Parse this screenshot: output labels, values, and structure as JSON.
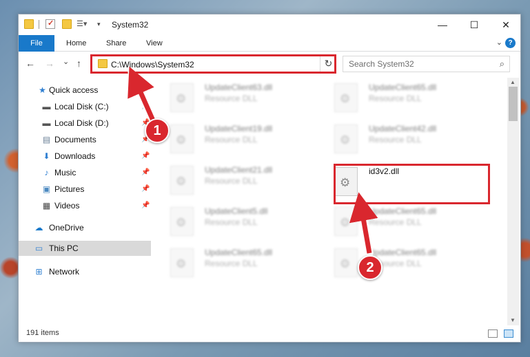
{
  "window": {
    "title": "System32",
    "minimize": "—",
    "maximize": "☐",
    "close": "✕"
  },
  "ribbon": {
    "tabs": [
      "File",
      "Home",
      "Share",
      "View"
    ],
    "help": "?"
  },
  "address": {
    "back": "←",
    "forward": "→",
    "recent": "⌄",
    "up": "↑",
    "path": "C:\\Windows\\System32",
    "search_placeholder": "Search System32"
  },
  "navpane": {
    "items": [
      {
        "label": "Quick access",
        "icon": "star-icon"
      },
      {
        "label": "Local Disk (C:)",
        "icon": "drive-icon",
        "pinned": true
      },
      {
        "label": "Local Disk (D:)",
        "icon": "drive-icon",
        "pinned": true
      },
      {
        "label": "Documents",
        "icon": "documents-icon",
        "pinned": true
      },
      {
        "label": "Downloads",
        "icon": "download-icon",
        "pinned": true
      },
      {
        "label": "Music",
        "icon": "music-icon",
        "pinned": true
      },
      {
        "label": "Pictures",
        "icon": "pictures-icon",
        "pinned": true
      },
      {
        "label": "Videos",
        "icon": "videos-icon",
        "pinned": true
      },
      {
        "label": "OneDrive",
        "icon": "cloud-icon"
      },
      {
        "label": "This PC",
        "icon": "computer-icon",
        "selected": true
      },
      {
        "label": "Network",
        "icon": "network-icon"
      }
    ]
  },
  "files": [
    {
      "name": "UpdateClient63.dll",
      "type": "Resource DLL"
    },
    {
      "name": "UpdateClient65.dll",
      "type": "Resource DLL"
    },
    {
      "name": "UpdateClient19.dll",
      "type": "Resource DLL"
    },
    {
      "name": "UpdateClient42.dll",
      "type": "Resource DLL"
    },
    {
      "name": "UpdateClient21.dll",
      "type": "Resource DLL"
    },
    {
      "name": "id3v2.dll",
      "type": ""
    },
    {
      "name": "UpdateClient5.dll",
      "type": "Resource DLL"
    },
    {
      "name": "UpdateClient65.dll",
      "type": "Resource DLL"
    },
    {
      "name": "UpdateClient65.dll",
      "type": "Resource DLL"
    },
    {
      "name": "UpdateClient65.dll",
      "type": "Resource DLL"
    }
  ],
  "status": {
    "item_count": "191 items"
  },
  "annotations": {
    "step1": "1",
    "step2": "2",
    "color": "#d9272e"
  },
  "colors": {
    "accent": "#1979ca",
    "highlight": "#d9272e",
    "selected_bg": "#d9d9d9"
  }
}
